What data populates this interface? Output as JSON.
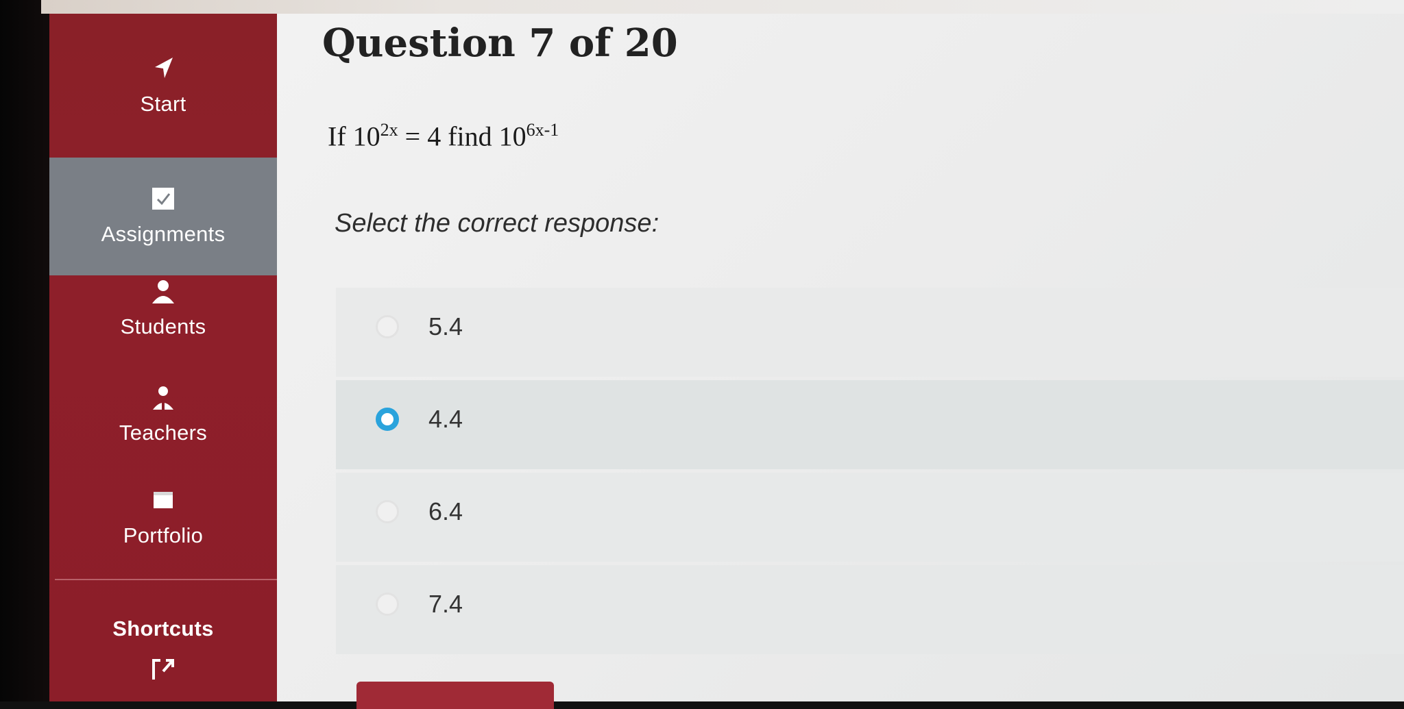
{
  "sidebar": {
    "items": [
      {
        "label": "Start",
        "icon": "location-arrow-icon"
      },
      {
        "label": "Assignments",
        "icon": "checklist-icon"
      },
      {
        "label": "Students",
        "icon": "user-icon"
      },
      {
        "label": "Teachers",
        "icon": "teacher-icon"
      },
      {
        "label": "Portfolio",
        "icon": "folder-icon"
      }
    ],
    "shortcuts_label": "Shortcuts",
    "active": "Assignments"
  },
  "question": {
    "title": "Question 7 of 20",
    "text_prefix": "If ",
    "base1": "10",
    "exp1": "2x",
    "eq": " = 4 find ",
    "base2": "10",
    "exp2": "6x-1",
    "prompt": "Select the correct response:"
  },
  "options": [
    {
      "value": "5.4",
      "selected": false
    },
    {
      "value": "4.4",
      "selected": true
    },
    {
      "value": "6.4",
      "selected": false
    },
    {
      "value": "7.4",
      "selected": false
    }
  ],
  "colors": {
    "sidebar": "#8c1e29",
    "active_item": "#7a7f86",
    "radio_selected": "#2aa3dc"
  }
}
